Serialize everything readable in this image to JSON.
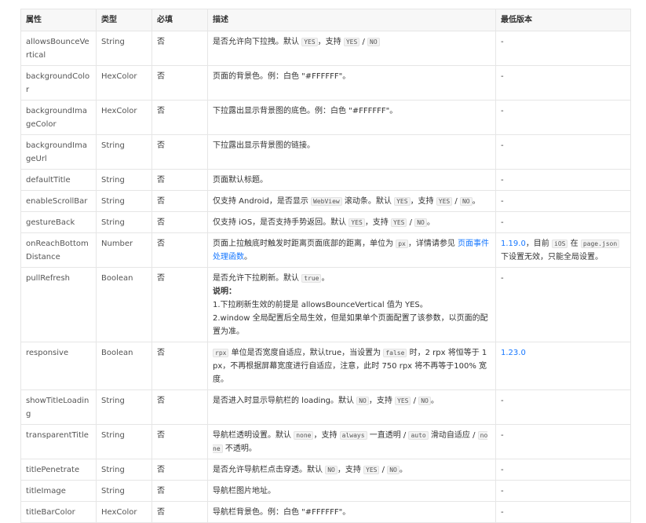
{
  "headers": {
    "attr": "属性",
    "type": "类型",
    "required": "必填",
    "desc": "描述",
    "min_version": "最低版本"
  },
  "rows": [
    {
      "name": "allowsBounceVertical",
      "type": "String",
      "required": "否",
      "desc": [
        {
          "t": "是否允许向下拉拽。默认 "
        },
        {
          "c": "YES"
        },
        {
          "t": "，支持 "
        },
        {
          "c": "YES"
        },
        {
          "t": " / "
        },
        {
          "c": "NO"
        }
      ],
      "version": [
        {
          "t": "-"
        }
      ]
    },
    {
      "name": "backgroundColor",
      "type": "HexColor",
      "required": "否",
      "desc": [
        {
          "t": "页面的背景色。例：白色 \"#FFFFFF\"。"
        }
      ],
      "version": [
        {
          "t": "-"
        }
      ]
    },
    {
      "name": "backgroundImageColor",
      "type": "HexColor",
      "required": "否",
      "desc": [
        {
          "t": "下拉露出显示背景图的底色。例：白色 \"#FFFFFF\"。"
        }
      ],
      "version": [
        {
          "t": "-"
        }
      ]
    },
    {
      "name": "backgroundImageUrl",
      "type": "String",
      "required": "否",
      "desc": [
        {
          "t": "下拉露出显示背景图的链接。"
        }
      ],
      "version": [
        {
          "t": "-"
        }
      ]
    },
    {
      "name": "defaultTitle",
      "type": "String",
      "required": "否",
      "desc": [
        {
          "t": "页面默认标题。"
        }
      ],
      "version": [
        {
          "t": "-"
        }
      ]
    },
    {
      "name": "enableScrollBar",
      "type": "String",
      "required": "否",
      "desc": [
        {
          "t": "仅支持 Android，是否显示 "
        },
        {
          "c": "WebView"
        },
        {
          "t": " 滚动条。默认 "
        },
        {
          "c": "YES"
        },
        {
          "t": "，支持 "
        },
        {
          "c": "YES"
        },
        {
          "t": " / "
        },
        {
          "c": "NO"
        },
        {
          "t": "。"
        }
      ],
      "version": [
        {
          "t": "-"
        }
      ]
    },
    {
      "name": "gestureBack",
      "type": "String",
      "required": "否",
      "desc": [
        {
          "t": "仅支持 iOS，是否支持手势返回。默认 "
        },
        {
          "c": "YES"
        },
        {
          "t": "，支持 "
        },
        {
          "c": "YES"
        },
        {
          "t": " / "
        },
        {
          "c": "NO"
        },
        {
          "t": "。"
        }
      ],
      "version": [
        {
          "t": "-"
        }
      ]
    },
    {
      "name": "onReachBottomDistance",
      "type": "Number",
      "required": "否",
      "desc": [
        {
          "t": "页面上拉触底时触发时距离页面底部的距离，单位为 "
        },
        {
          "c": "px"
        },
        {
          "t": "，详情请参见 "
        },
        {
          "a": "页面事件处理函数"
        },
        {
          "t": "。"
        }
      ],
      "version": [
        {
          "a": "1.19.0"
        },
        {
          "t": "，目前 "
        },
        {
          "c": "iOS"
        },
        {
          "t": " 在 "
        },
        {
          "c": "page.json"
        },
        {
          "t": " 下设置无效，只能全局设置。"
        }
      ]
    },
    {
      "name": "pullRefresh",
      "type": "Boolean",
      "required": "否",
      "desc": [
        {
          "t": "是否允许下拉刷新。默认 "
        },
        {
          "c": "true"
        },
        {
          "t": "。"
        },
        {
          "br": true
        },
        {
          "b": "说明："
        },
        {
          "br": true
        },
        {
          "t": "1.下拉刷新生效的前提是 allowsBounceVertical 值为 YES。"
        },
        {
          "br": true
        },
        {
          "t": "2.window 全局配置后全局生效，但是如果单个页面配置了该参数，以页面的配置为准。"
        }
      ],
      "version": [
        {
          "t": "-"
        }
      ]
    },
    {
      "name": "responsive",
      "type": "Boolean",
      "required": "否",
      "desc": [
        {
          "c": "rpx"
        },
        {
          "t": " 单位是否宽度自适应，默认true，当设置为 "
        },
        {
          "c": "false"
        },
        {
          "t": " 时，2 rpx 将恒等于 1 px，不再根据屏幕宽度进行自适应，注意，此时 750 rpx 将不再等于100% 宽度。"
        }
      ],
      "version": [
        {
          "a": "1.23.0"
        }
      ]
    },
    {
      "name": "showTitleLoading",
      "type": "String",
      "required": "否",
      "desc": [
        {
          "t": "是否进入时显示导航栏的 loading。默认 "
        },
        {
          "c": "NO"
        },
        {
          "t": "，支持 "
        },
        {
          "c": "YES"
        },
        {
          "t": " / "
        },
        {
          "c": "NO"
        },
        {
          "t": "。"
        }
      ],
      "version": [
        {
          "t": "-"
        }
      ]
    },
    {
      "name": "transparentTitle",
      "type": "String",
      "required": "否",
      "desc": [
        {
          "t": "导航栏透明设置。默认 "
        },
        {
          "c": "none"
        },
        {
          "t": "，支持 "
        },
        {
          "c": "always"
        },
        {
          "t": " 一直透明 / "
        },
        {
          "c": "auto"
        },
        {
          "t": " 滑动自适应 / "
        },
        {
          "c": "none"
        },
        {
          "t": " 不透明。"
        }
      ],
      "version": [
        {
          "t": "-"
        }
      ]
    },
    {
      "name": "titlePenetrate",
      "type": "String",
      "required": "否",
      "desc": [
        {
          "t": "是否允许导航栏点击穿透。默认 "
        },
        {
          "c": "NO"
        },
        {
          "t": "，支持 "
        },
        {
          "c": "YES"
        },
        {
          "t": " / "
        },
        {
          "c": "NO"
        },
        {
          "t": "。"
        }
      ],
      "version": [
        {
          "t": "-"
        }
      ]
    },
    {
      "name": "titleImage",
      "type": "String",
      "required": "否",
      "desc": [
        {
          "t": "导航栏图片地址。"
        }
      ],
      "version": [
        {
          "t": "-"
        }
      ]
    },
    {
      "name": "titleBarColor",
      "type": "HexColor",
      "required": "否",
      "desc": [
        {
          "t": "导航栏背景色。例：白色 \"#FFFFFF\"。"
        }
      ],
      "version": [
        {
          "t": "-"
        }
      ]
    }
  ]
}
